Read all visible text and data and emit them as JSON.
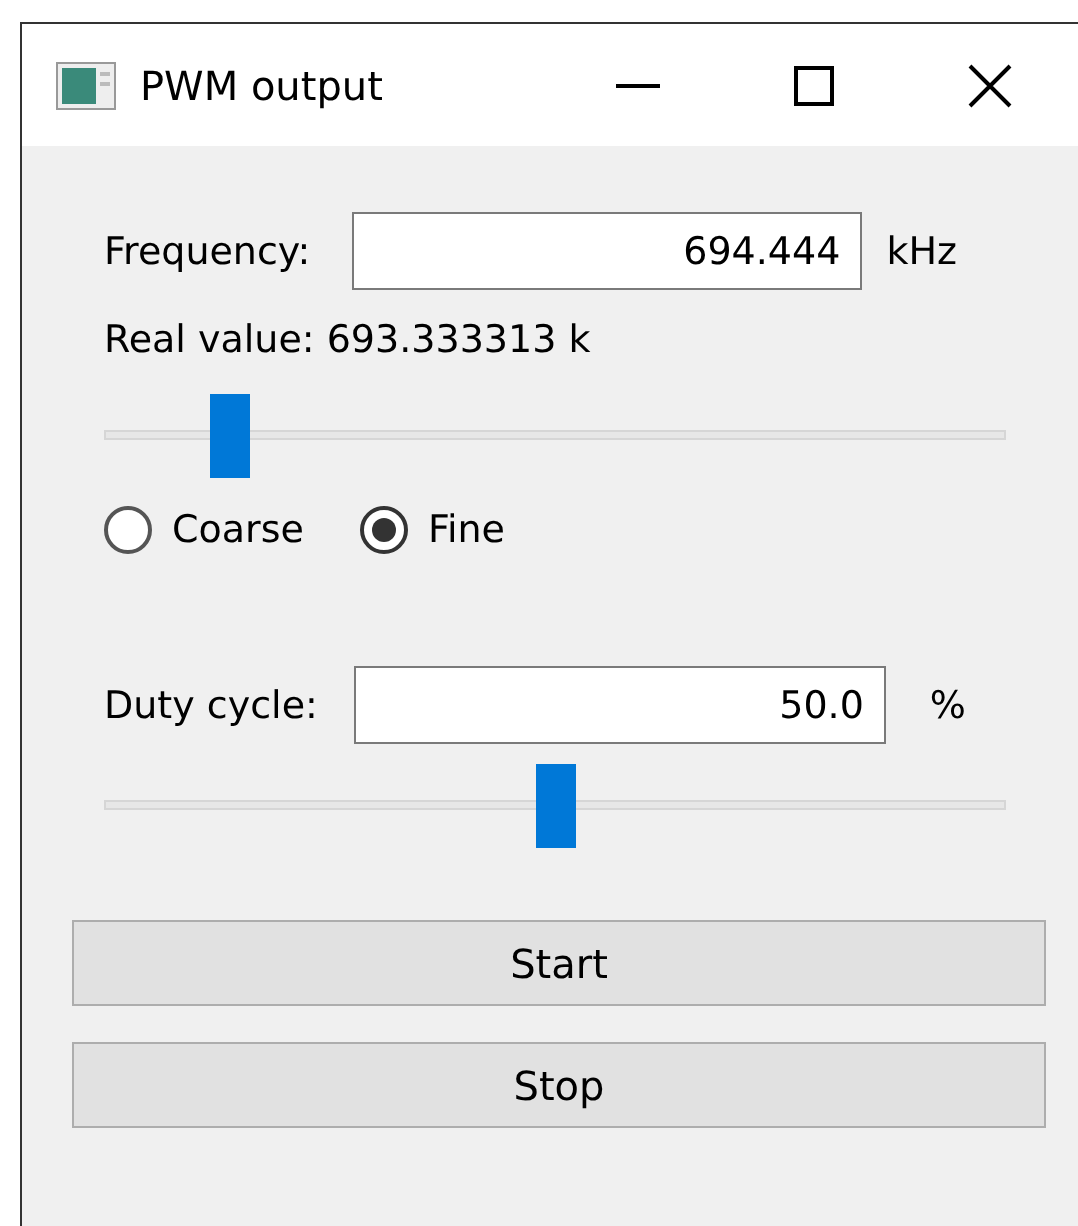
{
  "window": {
    "title": "PWM output"
  },
  "frequency": {
    "label": "Frequency:",
    "value": "694.444",
    "unit": "kHz",
    "real_value": "Real value: 693.333313 k",
    "level": 0.14
  },
  "modes": [
    {
      "label": "Coarse",
      "selected": false
    },
    {
      "label": "Fine",
      "selected": true
    }
  ],
  "duty_cycle": {
    "label": "Duty cycle:",
    "value": "50.0",
    "unit": "%",
    "level": 0.5
  },
  "buttons": [
    "Start",
    "Stop"
  ]
}
